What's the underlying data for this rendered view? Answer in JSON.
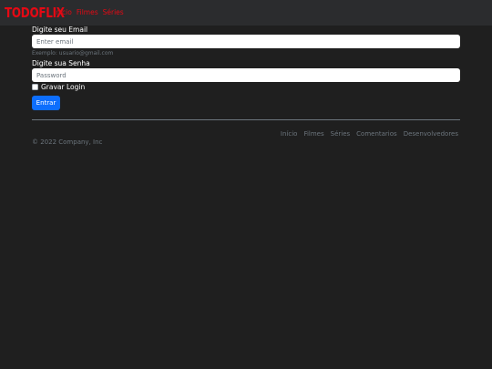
{
  "navbar": {
    "brand": "TODOFLIX",
    "links": [
      "Início",
      "Filmes",
      "Séries"
    ]
  },
  "form": {
    "email_label": "Digite seu Email",
    "email_placeholder": "Enter email",
    "email_help": "Exemplo: usuario@gmail.com",
    "password_label": "Digite sua Senha",
    "password_placeholder": "Password",
    "remember_label": "Gravar Login",
    "remember_checked": false,
    "submit_label": "Entrar"
  },
  "footer": {
    "copyright": "© 2022 Company, Inc",
    "links": [
      "Início",
      "Filmes",
      "Séries",
      "Comentarios",
      "Desenvolvedores"
    ]
  },
  "colors": {
    "background": "#1f1f1f",
    "navbar": "#2b2c2e",
    "brand": "#e50914",
    "primary_button": "#0d6efd",
    "muted_text": "#6c757d"
  }
}
